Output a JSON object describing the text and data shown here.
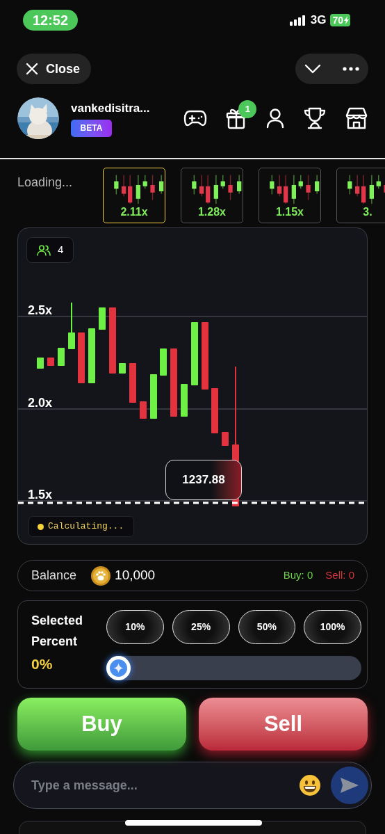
{
  "status_bar": {
    "time": "12:52",
    "network": "3G",
    "battery": "70"
  },
  "header": {
    "close_label": "Close"
  },
  "profile": {
    "username": "vankedisitra...",
    "badge": "BETA",
    "gift_count": "1"
  },
  "rounds": {
    "status": "Loading...",
    "items": [
      {
        "multiplier": "2.11x",
        "selected": true
      },
      {
        "multiplier": "1.28x",
        "selected": false
      },
      {
        "multiplier": "1.15x",
        "selected": false
      },
      {
        "multiplier": "3.",
        "selected": false
      }
    ]
  },
  "chart": {
    "players": "4",
    "y_labels": [
      "2.5x",
      "2.0x",
      "1.5x"
    ],
    "price": "1237.88",
    "status": "Calculating..."
  },
  "balance": {
    "label": "Balance",
    "amount": "10,000",
    "buy": "Buy: 0",
    "sell": "Sell: 0"
  },
  "percent": {
    "label": "Selected Percent",
    "value": "0%",
    "presets": [
      "10%",
      "25%",
      "50%",
      "100%"
    ],
    "slider": {
      "level": 0
    }
  },
  "actions": [
    {
      "label": "Buy",
      "kind": "buy"
    },
    {
      "label": "Sell",
      "kind": "sell"
    }
  ],
  "message": {
    "placeholder": "Type a message..."
  }
}
